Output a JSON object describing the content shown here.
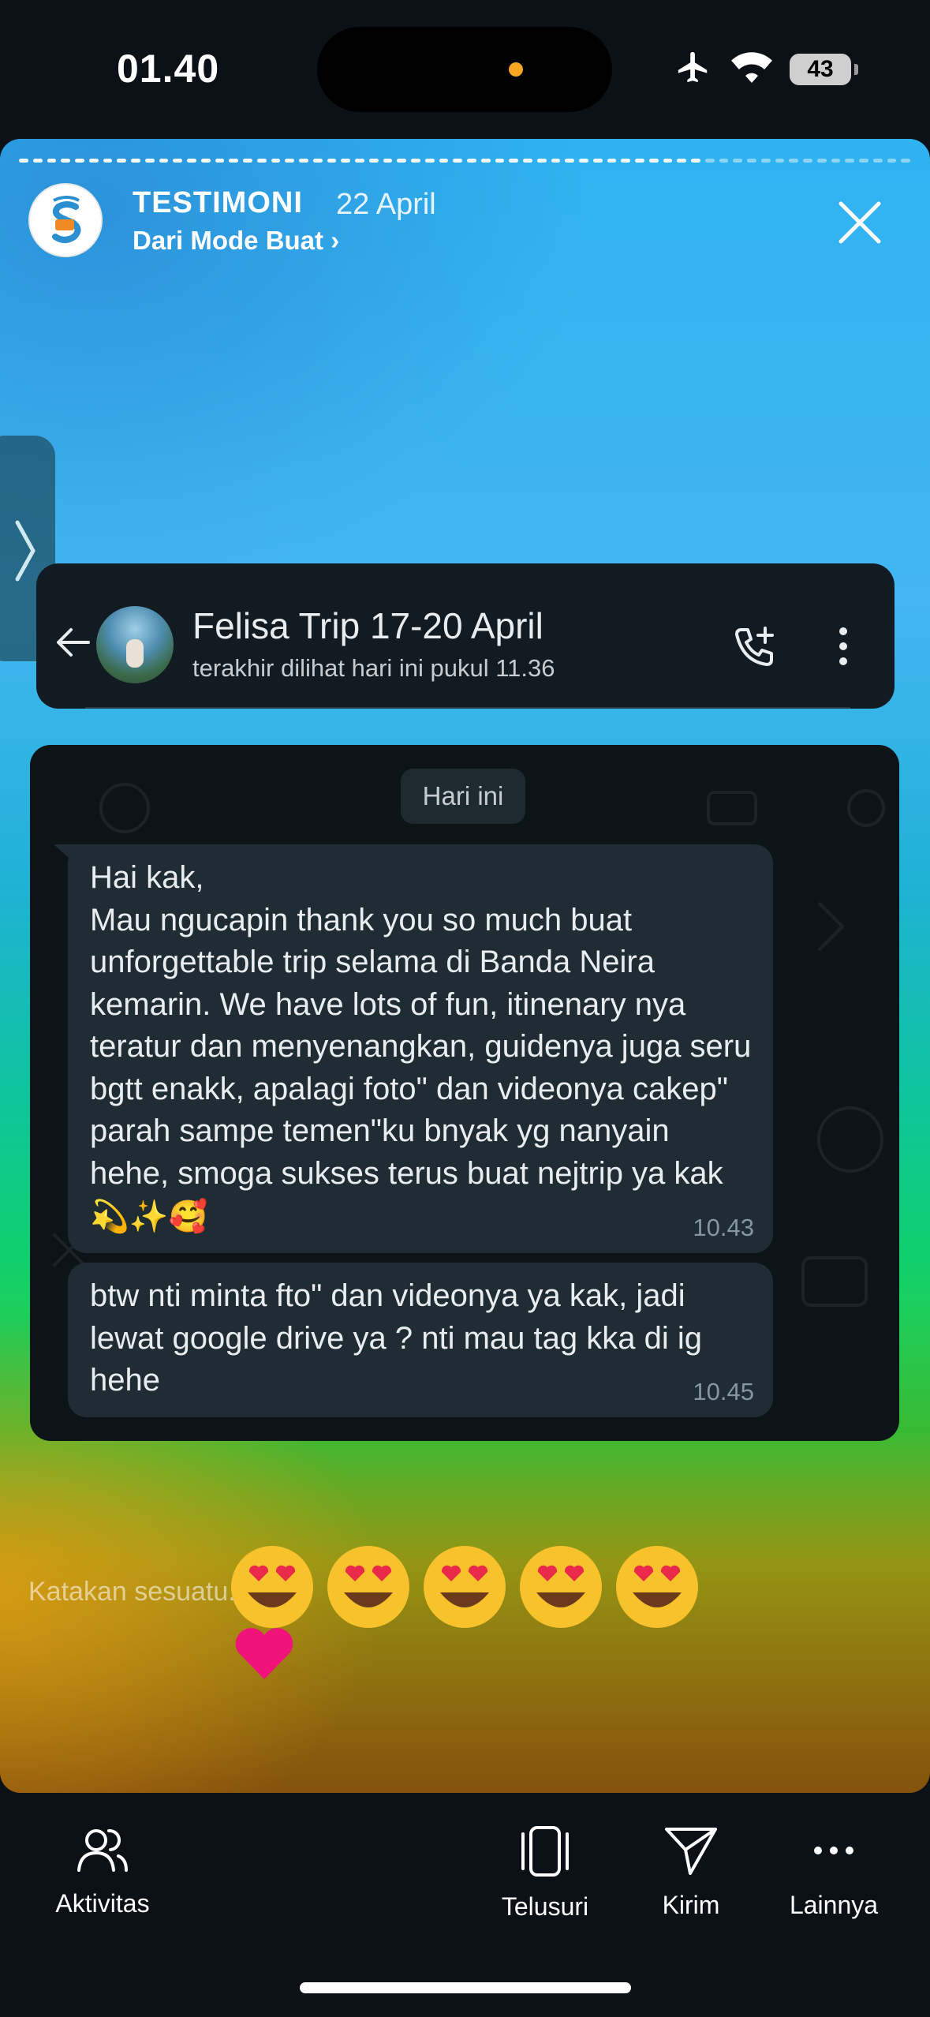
{
  "status_bar": {
    "time": "01.40",
    "battery": "43"
  },
  "story": {
    "title": "TESTIMONI",
    "date": "22 April",
    "subtitle": "Dari Mode Buat ›",
    "reply_placeholder": "Katakan sesuatu...",
    "reaction_emojis": [
      "heart-eyes",
      "heart-eyes",
      "heart-eyes",
      "heart-eyes",
      "heart-eyes"
    ]
  },
  "chat": {
    "contact_name": "Felisa Trip 17-20 April",
    "contact_status": "terakhir dilihat hari ini pukul 11.36",
    "day_label": "Hari ini",
    "messages": [
      {
        "text": "Hai kak,\nMau ngucapin thank you so much buat unforgettable trip selama di Banda Neira kemarin. We have lots of fun, itinenary nya teratur dan menyenangkan, guidenya juga seru bgtt enakk, apalagi foto\" dan videonya cakep\" parah sampe temen\"ku bnyak yg nanyain hehe, smoga sukses terus buat nejtrip ya kak",
        "emojis": "💫✨🥰",
        "time": "10.43"
      },
      {
        "text": "btw nti minta fto\" dan videonya ya kak, jadi lewat google drive ya ? nti mau tag kka di ig hehe",
        "time": "10.45"
      }
    ]
  },
  "bottom_nav": {
    "aktivitas": "Aktivitas",
    "telusuri": "Telusuri",
    "kirim": "Kirim",
    "lainnya": "Lainnya"
  },
  "colors": {
    "bubble": "#202c33",
    "chat_bg": "#0d1418",
    "header_bg": "#121b22",
    "accent_orange": "#f5a623"
  }
}
